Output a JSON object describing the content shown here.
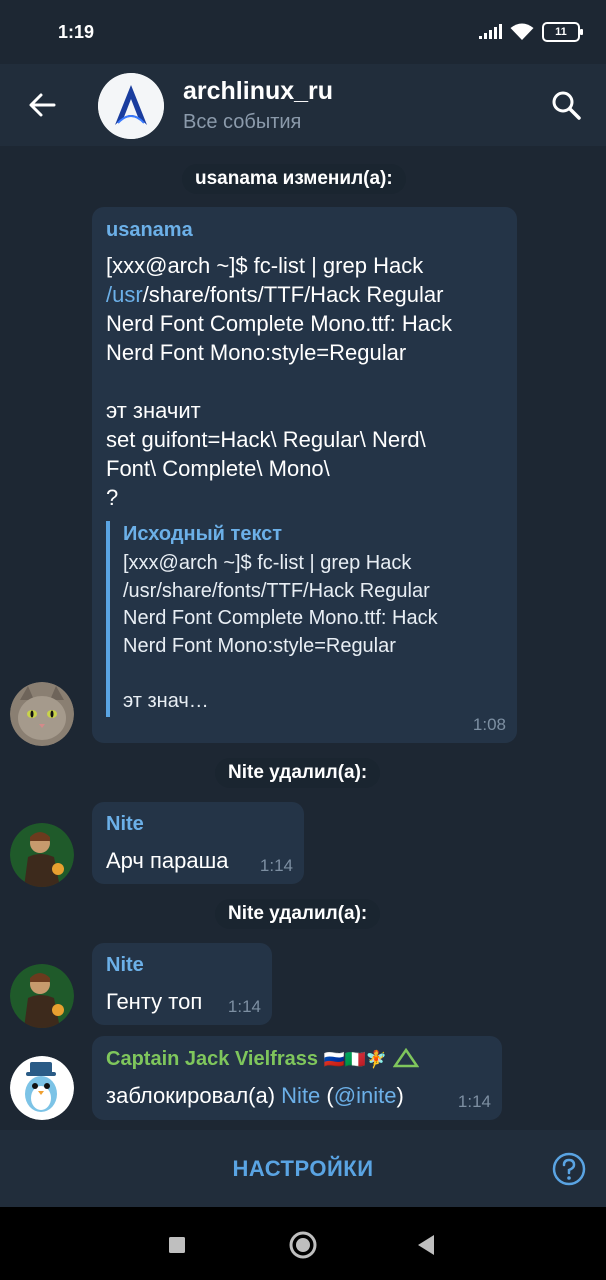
{
  "status_bar": {
    "time": "1:19",
    "battery": "11"
  },
  "header": {
    "title": "archlinux_ru",
    "subtitle": "Все события"
  },
  "messages": [
    {
      "type": "service",
      "text": "usanama изменил(а):"
    },
    {
      "type": "message",
      "sender": "usanama",
      "lines": [
        "[xxx@arch ~]$ fc-list | grep Hack",
        "/usr",
        "/share/fonts/TTF/Hack Regular",
        "Nerd Font Complete Mono.ttf: Hack",
        "Nerd Font Mono:style=Regular",
        "",
        "эт значит",
        "set guifont=Hack\\ Regular\\ Nerd\\",
        "Font\\ Complete\\ Mono\\",
        "?"
      ],
      "quote_title": "Исходный текст",
      "quote_text": "[xxx@arch ~]$ fc-list | grep Hack\n/usr/share/fonts/TTF/Hack Regular\nNerd Font Complete Mono.ttf: Hack\nNerd Font Mono:style=Regular\n\nэт знач…",
      "time": "1:08"
    },
    {
      "type": "service",
      "text": "Nite удалил(а):"
    },
    {
      "type": "message",
      "sender": "Nite",
      "text": "Арч параша",
      "time": "1:14"
    },
    {
      "type": "service",
      "text": "Nite удалил(а):"
    },
    {
      "type": "message",
      "sender": "Nite",
      "text": "Генту топ",
      "time": "1:14"
    },
    {
      "type": "action",
      "sender": "Captain Jack Vielfrass",
      "sender_flags": "🇷🇺🇮🇹🧚",
      "action": "заблокировал(а)",
      "target": "Nite",
      "target_handle": "@inite",
      "open_paren": "(",
      "close_paren": ")",
      "time": "1:14"
    }
  ],
  "bottom_bar": {
    "settings_label": "НАСТРОЙКИ"
  },
  "colors": {
    "background": "#1d2733",
    "bubble": "#243447",
    "accent": "#6cb0e8",
    "green_name": "#7fc65c"
  }
}
